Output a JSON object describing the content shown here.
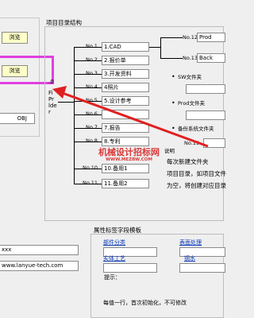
{
  "colors": {
    "highlight_border": "#e040e0",
    "arrow": "#e02020",
    "button_fill": "#ffffc8",
    "link": "#0a3ab8",
    "watermark": "#d83a3a"
  },
  "left": {
    "browse1": "浏览",
    "browse2": "浏览",
    "obj_suffix": "OBJ",
    "url_line1": "xxx",
    "url_line2": "www.lanyue-tech.com"
  },
  "tree": {
    "title": "项目目录结构",
    "root_lines": [
      ".0",
      "Fi",
      "Pr",
      "lde",
      "r"
    ],
    "nodes": [
      {
        "num": "No.1",
        "label": "1.CAD"
      },
      {
        "num": "No.2",
        "label": "2.报价单"
      },
      {
        "num": "No.3",
        "label": "3.开发资料"
      },
      {
        "num": "No.4",
        "label": "4照片"
      },
      {
        "num": "No.5",
        "label": "5.设计参考"
      },
      {
        "num": "No.6",
        "label": ""
      },
      {
        "num": "No.7",
        "label": "7.报告"
      },
      {
        "num": "No.8",
        "label": "8.专利"
      },
      {
        "num": "No.10",
        "label": "10.备用1"
      },
      {
        "num": "No.11",
        "label": "11.备用2"
      }
    ],
    "sub_nodes": [
      {
        "num": "No.12",
        "label": "Prod"
      },
      {
        "num": "No.13",
        "label": "Back"
      }
    ],
    "bullets": [
      "SW文件夹",
      "Prod文件夹",
      "备份系统文件夹"
    ],
    "no15": "No.15",
    "side_label": "说明"
  },
  "info": {
    "line1": "每次新建文件夹",
    "line2": "项目目录，如项目文件",
    "line3": "为空，将创建对应目录"
  },
  "watermark": {
    "main": "机械设计招标网",
    "sub": "WWW.MEZBW.COM"
  },
  "attributes": {
    "title": "属性标签字段模板",
    "links": [
      "部件分类",
      "表面处理",
      "实体工艺",
      "钢水"
    ],
    "hint": "提示：",
    "note": "每值一行，首次初始化，不可修改"
  }
}
